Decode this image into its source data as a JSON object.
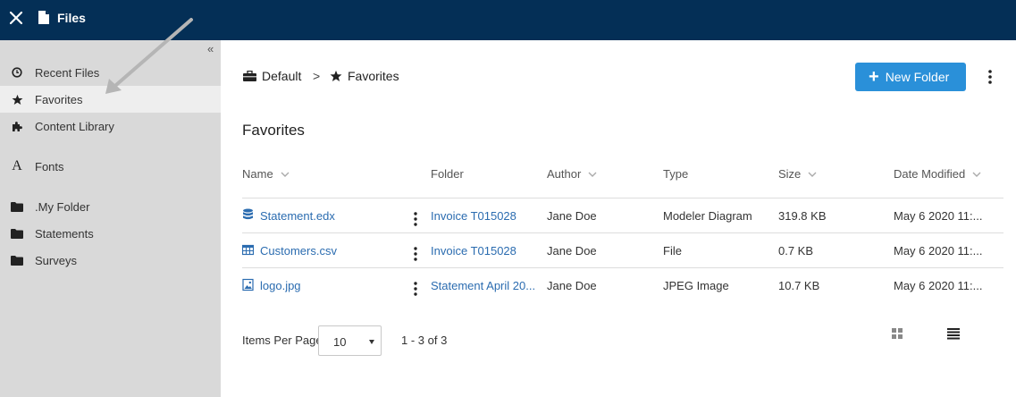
{
  "app": {
    "title": "Files"
  },
  "sidebar": {
    "collapse_label": "«",
    "items": [
      {
        "label": "Recent Files",
        "icon": "clock-icon"
      },
      {
        "label": "Favorites",
        "icon": "star-icon",
        "active": true
      },
      {
        "label": "Content Library",
        "icon": "puzzle-icon"
      },
      {
        "label": "Fonts",
        "icon": "font-icon"
      },
      {
        "label": ".My Folder",
        "icon": "folder-icon"
      },
      {
        "label": "Statements",
        "icon": "folder-icon"
      },
      {
        "label": "Surveys",
        "icon": "folder-icon"
      }
    ]
  },
  "breadcrumb": {
    "root": "Default",
    "separator": ">",
    "current": "Favorites"
  },
  "toolbar": {
    "new_folder_label": "New Folder",
    "accent": "#2a90d9"
  },
  "section_title": "Favorites",
  "table": {
    "columns": [
      "Name",
      "Folder",
      "Author",
      "Type",
      "Size",
      "Date Modified"
    ],
    "rows": [
      {
        "name": "Statement.edx",
        "icon": "database-icon",
        "folder": "Invoice T015028",
        "author": "Jane Doe",
        "type": "Modeler Diagram",
        "size": "319.8 KB",
        "date": "May 6 2020 11:..."
      },
      {
        "name": "Customers.csv",
        "icon": "table-icon",
        "folder": "Invoice T015028",
        "author": "Jane Doe",
        "type": "File",
        "size": "0.7 KB",
        "date": "May 6 2020 11:..."
      },
      {
        "name": "logo.jpg",
        "icon": "image-icon",
        "folder": "Statement April 20...",
        "author": "Jane Doe",
        "type": "JPEG Image",
        "size": "10.7 KB",
        "date": "May 6 2020 11:..."
      }
    ]
  },
  "pagination": {
    "items_per_page_label": "Items Per Page",
    "items_per_page_value": "10",
    "range_text": "1 - 3 of 3"
  },
  "colors": {
    "topbar": "#042f56",
    "sidebar": "#d9d9d9",
    "link": "#2b6cb0"
  }
}
